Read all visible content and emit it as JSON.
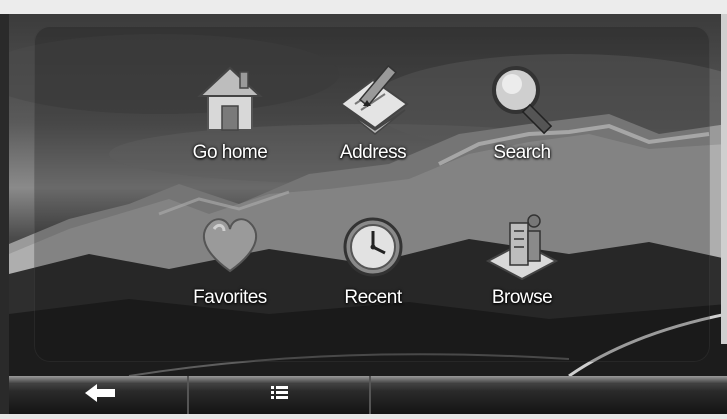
{
  "menu": {
    "items": [
      {
        "label": "Go home",
        "icon": "house-icon"
      },
      {
        "label": "Address",
        "icon": "address-pen-icon"
      },
      {
        "label": "Search",
        "icon": "magnifier-icon"
      },
      {
        "label": "Favorites",
        "icon": "heart-icon"
      },
      {
        "label": "Recent",
        "icon": "clock-icon"
      },
      {
        "label": "Browse",
        "icon": "map-building-icon"
      }
    ]
  },
  "bottom_bar": {
    "back_icon": "back-arrow-icon",
    "list_icon": "list-icon"
  }
}
